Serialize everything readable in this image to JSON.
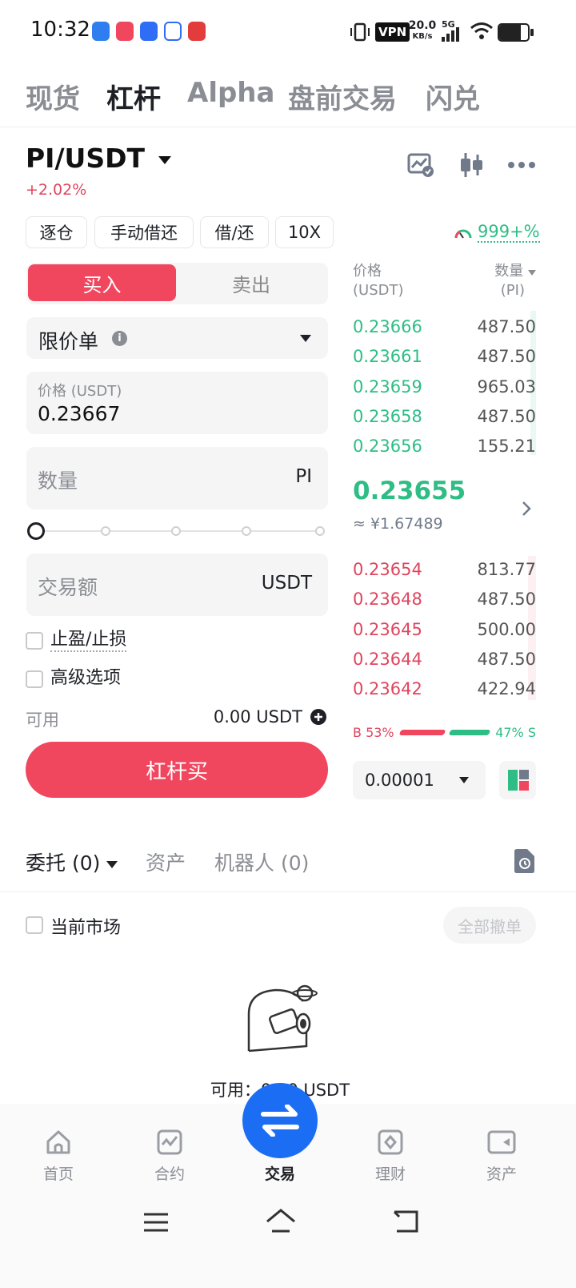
{
  "status_bar": {
    "time": "10:32",
    "vpn": "VPN",
    "speed_value": "20.0",
    "speed_unit": "KB/s",
    "network": "5G",
    "battery_level": 0.75
  },
  "top_tabs": [
    "现货",
    "杠杆",
    "Alpha",
    "盘前交易",
    "闪兑"
  ],
  "active_tab": 1,
  "pair": {
    "symbol": "PI/USDT",
    "change": "+2.02%"
  },
  "chips": [
    "逐仓",
    "手动借还",
    "借/还",
    "10X"
  ],
  "risk_ratio": "999+%",
  "order_form": {
    "buy_label": "买入",
    "sell_label": "卖出",
    "order_type": "限价单",
    "price_label": "价格 (USDT)",
    "price_value": "0.23667",
    "qty_placeholder": "数量",
    "qty_unit": "PI",
    "amount_placeholder": "交易额",
    "amount_unit": "USDT",
    "tp_sl_label": "止盈/止损",
    "advanced_label": "高级选项",
    "available_label": "可用",
    "available_value": "0.00 USDT",
    "submit_label": "杠杆买"
  },
  "order_book": {
    "price_header_1": "价格",
    "price_header_2": "(USDT)",
    "qty_header_1": "数量",
    "qty_header_2": "(PI)",
    "asks": [
      {
        "price": "0.23666",
        "qty": "487.50"
      },
      {
        "price": "0.23661",
        "qty": "487.50"
      },
      {
        "price": "0.23659",
        "qty": "965.03"
      },
      {
        "price": "0.23658",
        "qty": "487.50"
      },
      {
        "price": "0.23656",
        "qty": "155.21"
      }
    ],
    "last_price": "0.23655",
    "last_price_cny": "≈ ¥1.67489",
    "bids": [
      {
        "price": "0.23654",
        "qty": "813.77"
      },
      {
        "price": "0.23648",
        "qty": "487.50"
      },
      {
        "price": "0.23645",
        "qty": "500.00"
      },
      {
        "price": "0.23644",
        "qty": "487.50"
      },
      {
        "price": "0.23642",
        "qty": "422.94"
      }
    ],
    "buy_ratio": "B 53%",
    "sell_ratio": "47% S",
    "buy_ratio_value": 53,
    "precision": "0.00001"
  },
  "bottom_tabs": {
    "orders": "委托 (0)",
    "assets": "资产",
    "bots": "机器人 (0)"
  },
  "current_market_label": "当前市场",
  "cancel_all_label": "全部撤单",
  "empty_available": "可用：0.00 USDT",
  "nav": [
    "首页",
    "合约",
    "交易",
    "理财",
    "资产"
  ],
  "colors": {
    "buy": "#f0465e",
    "ask_green": "#2ebd85",
    "bid_red": "#e0455e",
    "fab_blue": "#1b6ef3"
  }
}
